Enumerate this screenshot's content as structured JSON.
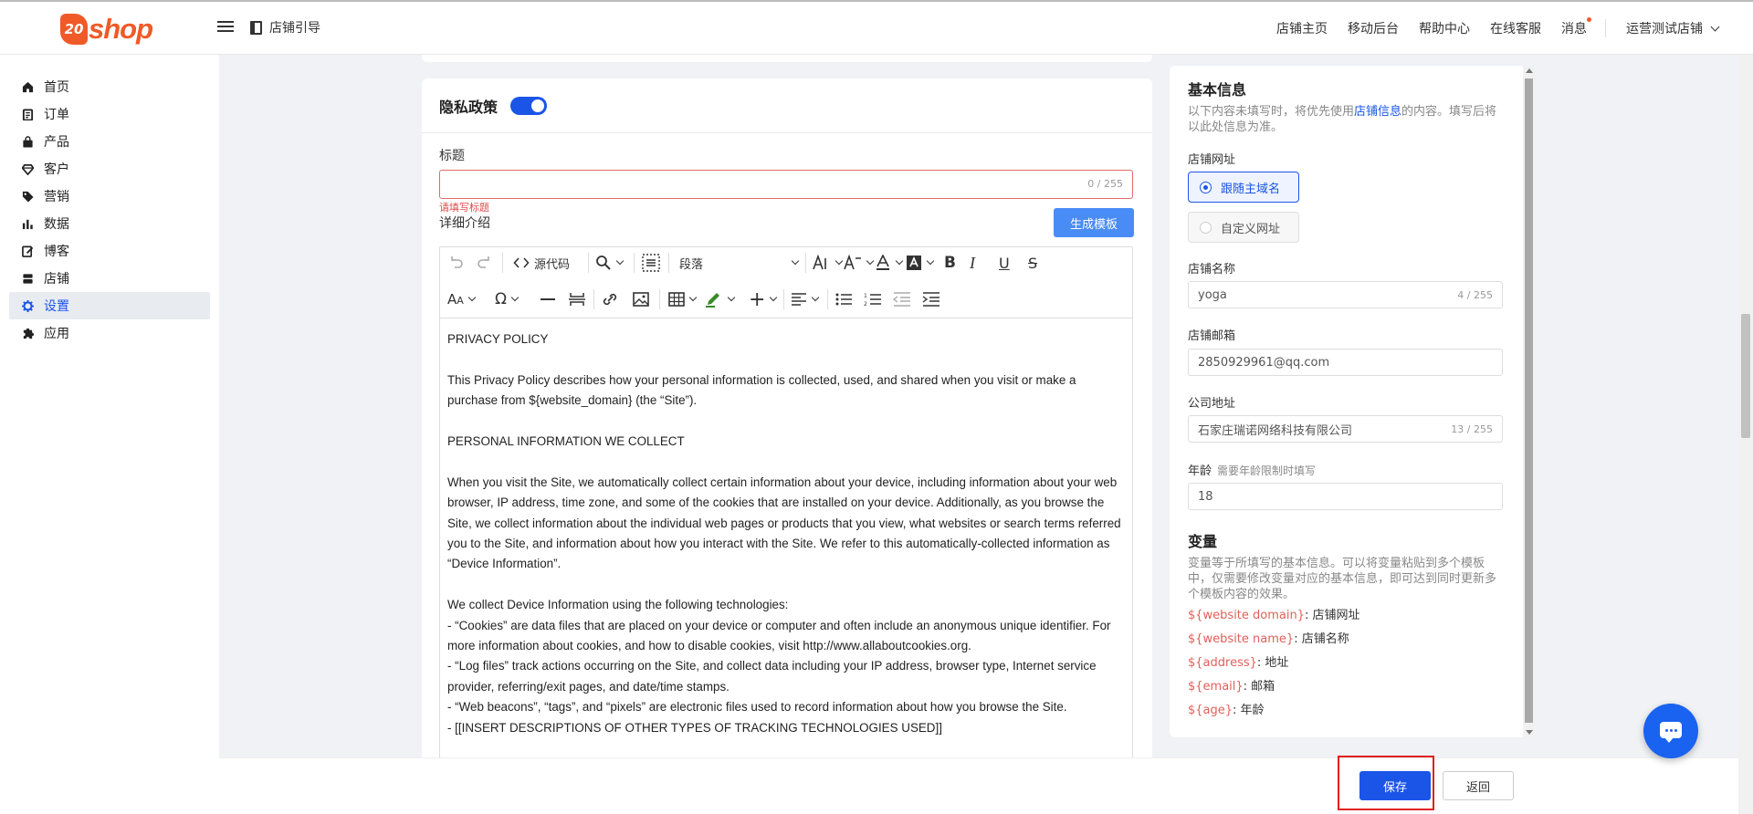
{
  "header": {
    "logo_num": "20",
    "logo_word": "shop",
    "guide": "店铺引导",
    "nav": [
      "店铺主页",
      "移动后台",
      "帮助中心",
      "在线客服",
      "消息"
    ],
    "store": "运营测试店铺"
  },
  "sidebar": {
    "items": [
      {
        "label": "首页",
        "icon": "home-icon"
      },
      {
        "label": "订单",
        "icon": "clipboard-icon"
      },
      {
        "label": "产品",
        "icon": "bag-icon"
      },
      {
        "label": "客户",
        "icon": "diamond-icon"
      },
      {
        "label": "营销",
        "icon": "tag-icon"
      },
      {
        "label": "数据",
        "icon": "bar-chart-icon"
      },
      {
        "label": "博客",
        "icon": "edit-icon"
      },
      {
        "label": "店铺",
        "icon": "store-icon"
      },
      {
        "label": "设置",
        "icon": "gear-icon",
        "active": true
      },
      {
        "label": "应用",
        "icon": "puzzle-icon"
      }
    ]
  },
  "policy": {
    "section_title": "隐私政策",
    "enabled": true,
    "title_label": "标题",
    "title_value": "",
    "title_count": "0 / 255",
    "title_error": "请填写标题",
    "detail_label": "详细介绍",
    "generate_btn": "生成模板",
    "toolbar": {
      "source": "源代码",
      "paragraph": "段落"
    },
    "content": [
      "PRIVACY POLICY",
      "",
      "This Privacy Policy describes how your personal information is collected, used, and shared when you visit or make a purchase from ${website_domain} (the “Site”).",
      "",
      "PERSONAL INFORMATION WE COLLECT",
      "",
      "When you visit the Site, we automatically collect certain information about your device, including information about your web browser, IP address, time zone, and some of the cookies that are installed on your device. Additionally, as you browse the Site, we collect information about the individual web pages or products that you view, what websites or search terms referred you to the Site, and information about how you interact with the Site. We refer to this automatically-collected information as “Device Information”.",
      "",
      "We collect Device Information using the following technologies:",
      "- “Cookies” are data files that are placed on your device or computer and often include an anonymous unique identifier. For more information about cookies, and how to disable cookies, visit http://www.allaboutcookies.org.",
      "- “Log files” track actions occurring on the Site, and collect data including your IP address, browser type, Internet service provider, referring/exit pages, and date/time stamps.",
      "- “Web beacons”, “tags”, and “pixels” are electronic files used to record information about how you browse the Site.",
      "- [[INSERT DESCRIPTIONS OF OTHER TYPES OF TRACKING TECHNOLOGIES USED]]"
    ]
  },
  "basic": {
    "title": "基本信息",
    "note_pre": "以下内容未填写时，将优先使用",
    "note_link": "店铺信息",
    "note_post": "的内容。填写后将以此处信息为准。",
    "url_label": "店铺网址",
    "url_options": [
      "跟随主域名",
      "自定义网址"
    ],
    "url_selected": 0,
    "name_label": "店铺名称",
    "name_value": "yoga",
    "name_count": "4 / 255",
    "email_label": "店铺邮箱",
    "email_value": "2850929961@qq.com",
    "addr_label": "公司地址",
    "addr_value": "石家庄瑞诺网络科技有限公司",
    "addr_count": "13 / 255",
    "age_label": "年龄",
    "age_hint": "需要年龄限制时填写",
    "age_value": "18"
  },
  "vars": {
    "title": "变量",
    "note": "变量等于所填写的基本信息。可以将变量粘贴到多个模板中，仅需要修改变量对应的基本信息，即可达到同时更新多个模板内容的效果。",
    "items": [
      {
        "key": "${website domain}",
        "val": ": 店铺网址"
      },
      {
        "key": "${website name}",
        "val": ": 店铺名称"
      },
      {
        "key": "${address}",
        "val": ": 地址"
      },
      {
        "key": "${email}",
        "val": ": 邮箱"
      },
      {
        "key": "${age}",
        "val": ": 年龄"
      }
    ]
  },
  "footer": {
    "save": "保存",
    "back": "返回"
  },
  "colors": {
    "accent": "#1a55e8",
    "brand": "#f05a28",
    "error": "#e04b4b",
    "highlight": "#e02020"
  }
}
